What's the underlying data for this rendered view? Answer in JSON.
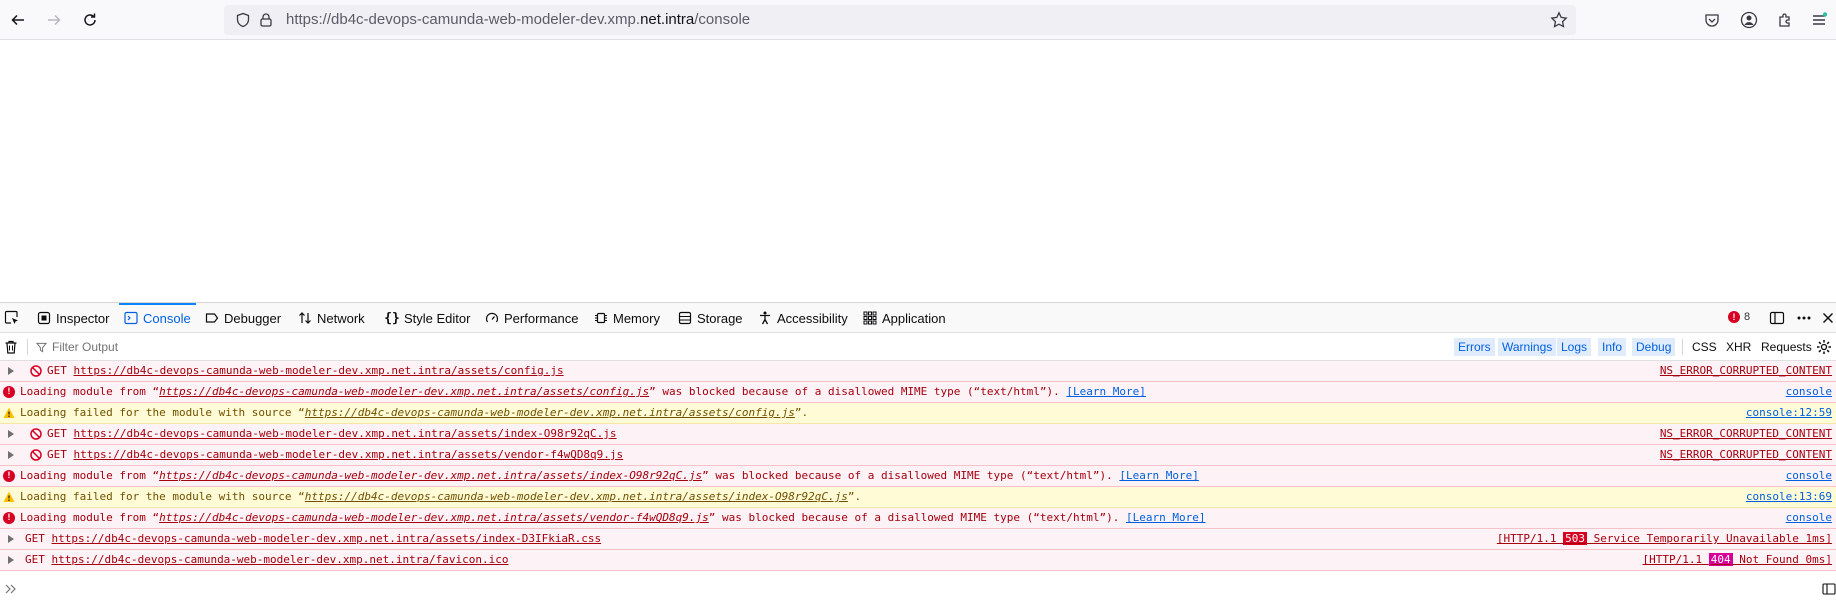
{
  "browser": {
    "url_prefix": "https://db4c-devops-camunda-web-modeler-dev.xmp.",
    "url_host": "net.intra",
    "url_path": "/console"
  },
  "devtools": {
    "tabs": [
      {
        "label": "Inspector"
      },
      {
        "label": "Console"
      },
      {
        "label": "Debugger"
      },
      {
        "label": "Network"
      },
      {
        "label": "Style Editor"
      },
      {
        "label": "Performance"
      },
      {
        "label": "Memory"
      },
      {
        "label": "Storage"
      },
      {
        "label": "Accessibility"
      },
      {
        "label": "Application"
      }
    ],
    "error_count": "8",
    "filter_placeholder": "Filter Output",
    "filters": [
      "Errors",
      "Warnings",
      "Logs",
      "Info",
      "Debug"
    ],
    "filters2": [
      "CSS",
      "XHR",
      "Requests"
    ]
  },
  "messages": [
    {
      "prefix": "GET ",
      "url": "https://db4c-devops-camunda-web-modeler-dev.xmp.net.intra/assets/config.js",
      "source": "NS_ERROR_CORRUPTED_CONTENT"
    },
    {
      "text1": "Loading module from “",
      "url": "https://db4c-devops-camunda-web-modeler-dev.xmp.net.intra/assets/config.js",
      "text2": "” was blocked because of a disallowed MIME type (“text/html”). ",
      "learn": "[Learn More]",
      "source": "console"
    },
    {
      "text1": "Loading failed for the module with source “",
      "url": "https://db4c-devops-camunda-web-modeler-dev.xmp.net.intra/assets/config.js",
      "text2": "”.",
      "source": "console:12:59"
    },
    {
      "prefix": "GET ",
      "url": "https://db4c-devops-camunda-web-modeler-dev.xmp.net.intra/assets/index-O98r92qC.js",
      "source": "NS_ERROR_CORRUPTED_CONTENT"
    },
    {
      "prefix": "GET ",
      "url": "https://db4c-devops-camunda-web-modeler-dev.xmp.net.intra/assets/vendor-f4wQD8q9.js",
      "source": "NS_ERROR_CORRUPTED_CONTENT"
    },
    {
      "text1": "Loading module from “",
      "url": "https://db4c-devops-camunda-web-modeler-dev.xmp.net.intra/assets/index-O98r92qC.js",
      "text2": "” was blocked because of a disallowed MIME type (“text/html”). ",
      "learn": "[Learn More]",
      "source": "console"
    },
    {
      "text1": "Loading failed for the module with source “",
      "url": "https://db4c-devops-camunda-web-modeler-dev.xmp.net.intra/assets/index-O98r92qC.js",
      "text2": "”.",
      "source": "console:13:69"
    },
    {
      "text1": "Loading module from “",
      "url": "https://db4c-devops-camunda-web-modeler-dev.xmp.net.intra/assets/vendor-f4wQD8q9.js",
      "text2": "” was blocked because of a disallowed MIME type (“text/html”). ",
      "learn": "[Learn More]",
      "source": "console"
    },
    {
      "prefix": "GET ",
      "url": "https://db4c-devops-camunda-web-modeler-dev.xmp.net.intra/assets/index-D3IFkiaR.css",
      "src_pre": "[HTTP/1.1 ",
      "status": "503",
      "src_post": " Service Temporarily Unavailable 1ms]"
    },
    {
      "prefix": "GET ",
      "url": "https://db4c-devops-camunda-web-modeler-dev.xmp.net.intra/favicon.ico",
      "src_pre": "[HTTP/1.1 ",
      "status": "404",
      "src_post": " Not Found 0ms]"
    }
  ],
  "colors": {
    "error": "#a4000f",
    "warning": "#715100",
    "accent": "#0060df",
    "status503": "#d70022",
    "status404": "#d70099"
  }
}
